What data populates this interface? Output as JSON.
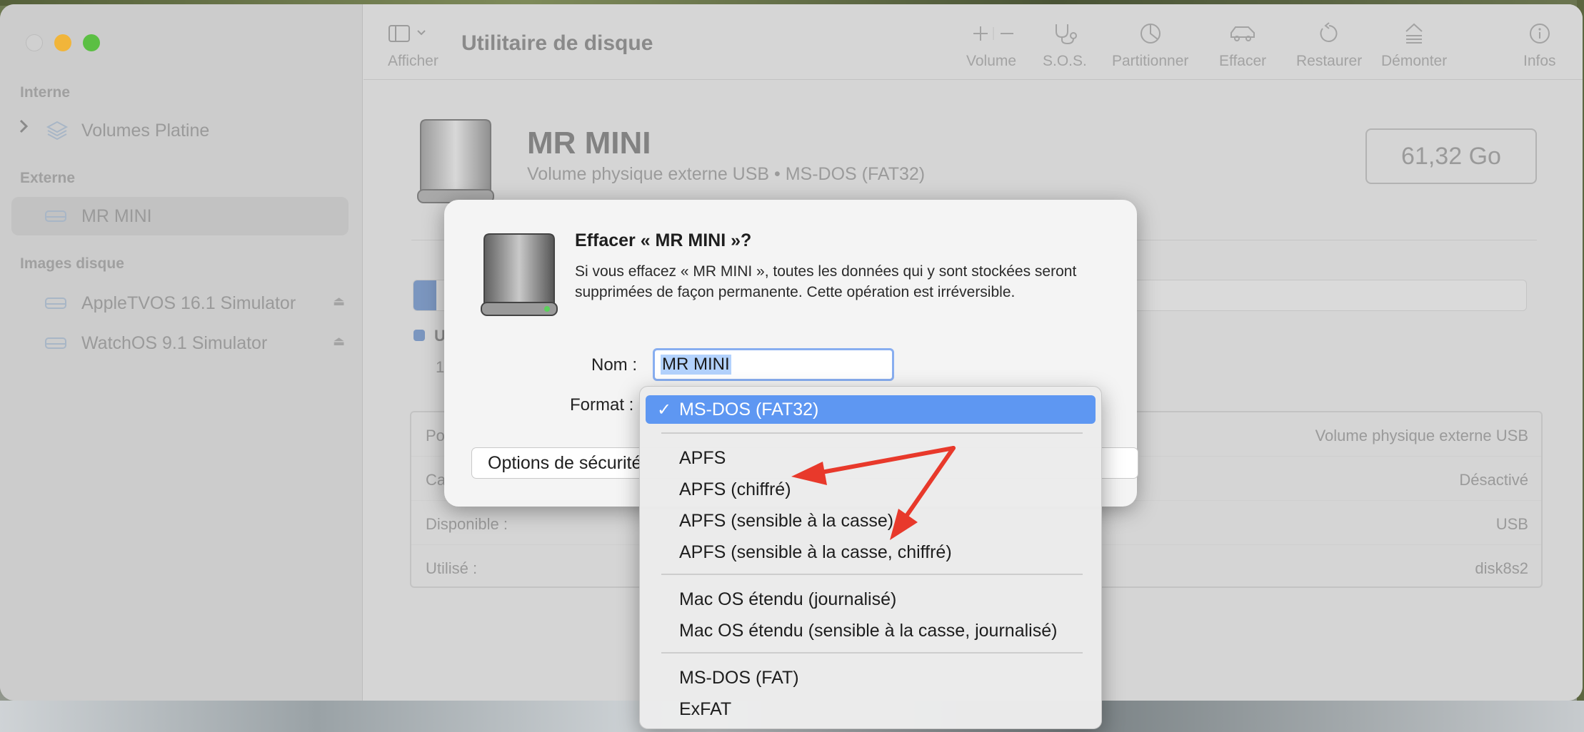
{
  "window": {
    "title": "Utilitaire de disque"
  },
  "toolbar": {
    "view_label": "Afficher",
    "buttons": [
      {
        "label": "Volume",
        "icon": "plus-minus-icon"
      },
      {
        "label": "S.O.S.",
        "icon": "stethoscope-icon"
      },
      {
        "label": "Partitionner",
        "icon": "pie-chart-icon"
      },
      {
        "label": "Effacer",
        "icon": "erase-car-icon"
      },
      {
        "label": "Restaurer",
        "icon": "restore-arrow-icon"
      },
      {
        "label": "Démonter",
        "icon": "unmount-icon"
      },
      {
        "label": "Infos",
        "icon": "info-icon"
      }
    ]
  },
  "sidebar": {
    "sections": [
      {
        "label": "Interne"
      },
      {
        "label": "Externe"
      },
      {
        "label": "Images disque"
      }
    ],
    "items": [
      {
        "label": "Volumes Platine"
      },
      {
        "label": "MR MINI"
      },
      {
        "label": "AppleTVOS 16.1 Simulator"
      },
      {
        "label": "WatchOS 9.1 Simulator"
      }
    ]
  },
  "disk": {
    "name": "MR MINI",
    "subtitle": "Volume physique externe USB • MS-DOS (FAT32)",
    "capacity": "61,32 Go",
    "legend_title": "U",
    "legend_value": "1,",
    "info_rows": [
      {
        "key": "Po",
        "value": "Volume physique externe USB"
      },
      {
        "key": "Ca",
        "value": "Désactivé"
      },
      {
        "key": "Disponible :",
        "value": "USB"
      },
      {
        "key": "Utilisé :",
        "value": "disk8s2"
      }
    ]
  },
  "dialog": {
    "title": "Effacer « MR MINI »?",
    "message": "Si vous effacez « MR MINI », toutes les données qui y sont stockées seront supprimées de façon permanente. Cette opération est irréversible.",
    "name_label": "Nom :",
    "name_value": "MR MINI",
    "format_label": "Format :",
    "options_button": "Options de sécurité"
  },
  "format_menu": {
    "selected": "MS-DOS (FAT32)",
    "check": "✓",
    "group_apfs": [
      "APFS",
      "APFS (chiffré)",
      "APFS (sensible à la casse)",
      "APFS (sensible à la casse, chiffré)"
    ],
    "group_mac": [
      "Mac OS étendu (journalisé)",
      "Mac OS étendu (sensible à la casse, journalisé)"
    ],
    "group_dos": [
      "MS-DOS (FAT)",
      "ExFAT"
    ]
  },
  "colors": {
    "accent": "#5e97f2",
    "annotation_arrow": "#e8392b",
    "traffic_min": "#f1b53a",
    "traffic_max": "#5bbf43"
  }
}
